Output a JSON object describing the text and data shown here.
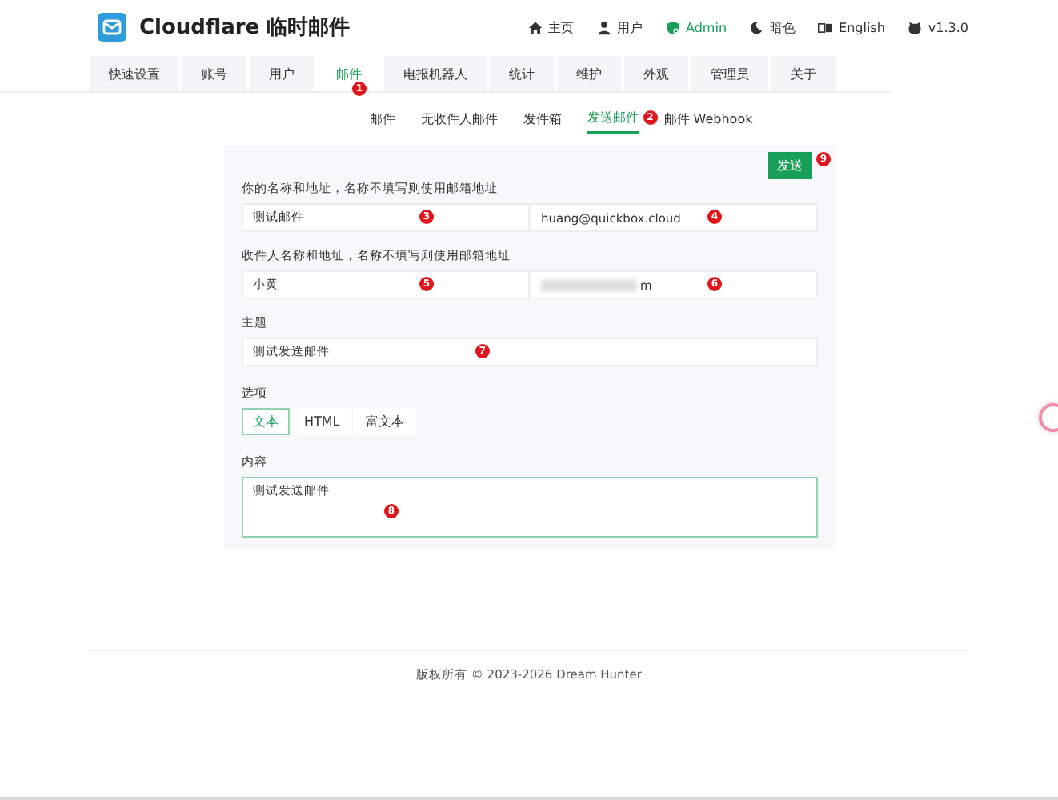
{
  "header": {
    "title": "Cloudflare 临时邮件",
    "nav": [
      {
        "kind": "home",
        "label": "主页",
        "selected": false
      },
      {
        "kind": "user",
        "label": "用户",
        "selected": false
      },
      {
        "kind": "admin",
        "label": "Admin",
        "selected": true
      },
      {
        "kind": "moon",
        "label": "暗色",
        "selected": false
      },
      {
        "kind": "lang",
        "label": "English",
        "selected": false
      },
      {
        "kind": "github",
        "label": "v1.3.0",
        "selected": false
      }
    ]
  },
  "tabs": [
    {
      "label": "快速设置",
      "selected": false
    },
    {
      "label": "账号",
      "selected": false
    },
    {
      "label": "用户",
      "selected": false
    },
    {
      "label": "邮件",
      "selected": true,
      "marker": "1"
    },
    {
      "label": "电报机器人",
      "selected": false
    },
    {
      "label": "统计",
      "selected": false
    },
    {
      "label": "维护",
      "selected": false
    },
    {
      "label": "外观",
      "selected": false
    },
    {
      "label": "管理员",
      "selected": false
    },
    {
      "label": "关于",
      "selected": false
    }
  ],
  "subtabs": [
    {
      "label": "邮件",
      "selected": false
    },
    {
      "label": "无收件人邮件",
      "selected": false
    },
    {
      "label": "发件箱",
      "selected": false
    },
    {
      "label": "发送邮件",
      "selected": true,
      "marker": "2"
    },
    {
      "label": "邮件 Webhook",
      "selected": false
    }
  ],
  "form": {
    "send_button": {
      "label": "发送",
      "marker": "9"
    },
    "sender": {
      "label": "你的名称和地址，名称不填写则使用邮箱地址",
      "name": {
        "value": "测试邮件",
        "marker": "3"
      },
      "address": {
        "value": "huang@quickbox.cloud",
        "marker": "4"
      }
    },
    "recipient": {
      "label": "收件人名称和地址，名称不填写则使用邮箱地址",
      "name": {
        "value": "小黄",
        "marker": "5"
      },
      "address": {
        "value": "m",
        "redacted": true,
        "marker": "6"
      }
    },
    "subject": {
      "label": "主题",
      "value": "测试发送邮件",
      "marker": "7"
    },
    "options": {
      "label": "选项",
      "items": [
        {
          "label": "文本",
          "selected": true
        },
        {
          "label": "HTML",
          "selected": false
        },
        {
          "label": "富文本",
          "selected": false
        }
      ]
    },
    "content": {
      "label": "内容",
      "value": "测试发送邮件",
      "marker": "8"
    }
  },
  "footer": {
    "text": "版权所有 © 2023-2026   Dream Hunter"
  }
}
